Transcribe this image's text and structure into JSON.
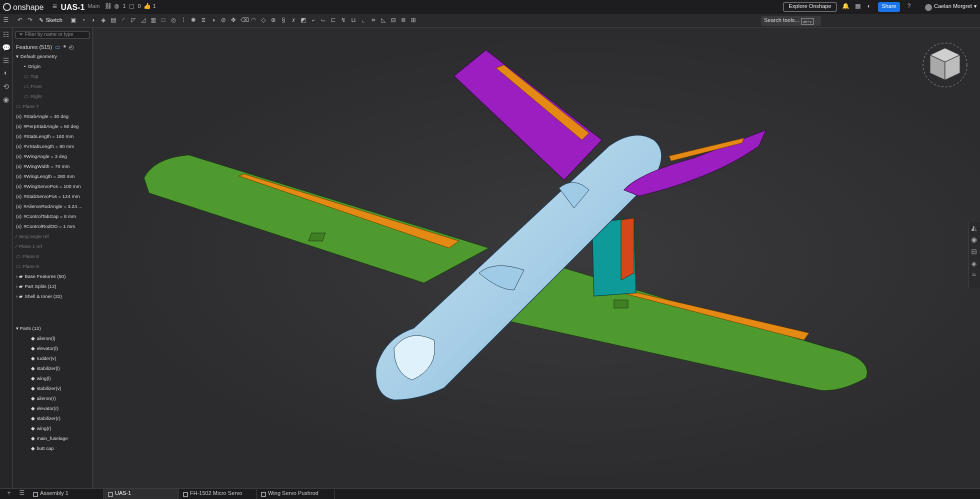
{
  "app": {
    "logo_text": "onshape",
    "doc_title": "UAS-1",
    "branch": "Main",
    "mini_counts": [
      "1",
      "0",
      "1"
    ],
    "explore_label": "Explore Onshape",
    "share_label": "Share",
    "user_name": "Caelan Morgret"
  },
  "toolbar": {
    "sketch_label": "Sketch",
    "search_label": "Search tools...",
    "search_shortcut": "alt+c"
  },
  "panel": {
    "filter_placeholder": "Filter by name or type",
    "features_header": "Features (515)",
    "tree": [
      {
        "label": "Default geometry",
        "level": 0,
        "dim": false,
        "prefix": "▾"
      },
      {
        "label": "Origin",
        "level": 1,
        "dim": false,
        "prefix": "•"
      },
      {
        "label": "Top",
        "level": 1,
        "dim": true,
        "prefix": "▭"
      },
      {
        "label": "Front",
        "level": 1,
        "dim": true,
        "prefix": "▭"
      },
      {
        "label": "Right",
        "level": 1,
        "dim": true,
        "prefix": "▭"
      },
      {
        "label": "Plane 7",
        "level": 0,
        "dim": true,
        "prefix": "▭"
      },
      {
        "label": "#StabAngle = 30 deg",
        "level": 0,
        "dim": false,
        "prefix": "(x)"
      },
      {
        "label": "#PerpStabAngle = 60 deg",
        "level": 0,
        "dim": false,
        "prefix": "(x)"
      },
      {
        "label": "#StabLength = 160 mm",
        "level": 0,
        "dim": false,
        "prefix": "(x)"
      },
      {
        "label": "#VStabLength = 80 mm",
        "level": 0,
        "dim": false,
        "prefix": "(x)"
      },
      {
        "label": "#WingAngle = 3 deg",
        "level": 0,
        "dim": false,
        "prefix": "(x)"
      },
      {
        "label": "#WingWidth = 70 mm",
        "level": 0,
        "dim": false,
        "prefix": "(x)"
      },
      {
        "label": "#WingLength = 280 mm",
        "level": 0,
        "dim": false,
        "prefix": "(x)"
      },
      {
        "label": "#WingServoPos = 100 mm",
        "level": 0,
        "dim": false,
        "prefix": "(x)"
      },
      {
        "label": "#StabServoPos = 124 mm",
        "level": 0,
        "dim": false,
        "prefix": "(x)"
      },
      {
        "label": "#AileronRodAngle = 3.24 ...",
        "level": 0,
        "dim": false,
        "prefix": "(x)"
      },
      {
        "label": "#ControlTabGap = 8 mm",
        "level": 0,
        "dim": false,
        "prefix": "(x)"
      },
      {
        "label": "#ControlRodOD = 1 mm",
        "level": 0,
        "dim": false,
        "prefix": "(x)"
      },
      {
        "label": "wing angle ref",
        "level": 0,
        "dim": true,
        "prefix": "∕"
      },
      {
        "label": "Plane 1 ref",
        "level": 0,
        "dim": true,
        "prefix": "∕"
      },
      {
        "label": "Plane 8",
        "level": 0,
        "dim": true,
        "prefix": "▭"
      },
      {
        "label": "Plane 9",
        "level": 0,
        "dim": true,
        "prefix": "▭"
      },
      {
        "label": "Base Features (50)",
        "level": 0,
        "dim": false,
        "prefix": "› ▰"
      },
      {
        "label": "Part Splits (12)",
        "level": 0,
        "dim": false,
        "prefix": "› ▰"
      },
      {
        "label": "Shell & Inner (32)",
        "level": 0,
        "dim": false,
        "prefix": "› ▰"
      }
    ],
    "parts_header": "Parts (12)",
    "parts": [
      "aileron(l)",
      "elevator(l)",
      "rudder(v)",
      "stabilizer(l)",
      "wing(l)",
      "stabilizer(v)",
      "aileron(r)",
      "elevator(r)",
      "stabilizer(r)",
      "wing(r)",
      "main_fuselage",
      "butt cap"
    ]
  },
  "tabs": [
    {
      "label": "Assembly 1",
      "active": false
    },
    {
      "label": "UAS-1",
      "active": true
    },
    {
      "label": "FH-1502 Micro Servo",
      "active": false
    },
    {
      "label": "Wing Servo Pushrod",
      "active": false
    }
  ],
  "colors": {
    "fuselage": "#a8d4ee",
    "wing": "#4f9a2e",
    "control_surface": "#e48a14",
    "stabilizer": "#9a1ec0",
    "vstab": "#0f9a9a",
    "rudder": "#d6461b",
    "accent": "#1a73e8"
  }
}
